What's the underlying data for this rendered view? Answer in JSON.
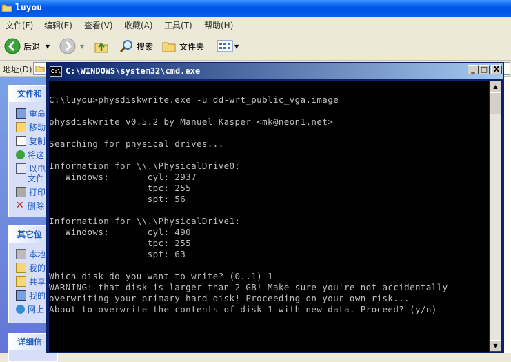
{
  "explorer": {
    "title": "luyou",
    "menu": [
      "文件(F)",
      "编辑(E)",
      "查看(V)",
      "收藏(A)",
      "工具(T)",
      "帮助(H)"
    ],
    "toolbar": {
      "back": "后退",
      "search": "搜索",
      "folders": "文件夹"
    },
    "address_label": "地址(D)",
    "panels": [
      {
        "title": "文件和",
        "items": [
          "重命",
          "移动",
          "复制",
          "将这",
          "以电",
          "文件",
          "打印",
          "删除"
        ]
      },
      {
        "title": "其它位",
        "items": [
          "本地",
          "我的",
          "共享",
          "我的",
          "网上"
        ]
      },
      {
        "title": "详细信",
        "items": []
      }
    ]
  },
  "cmd": {
    "title": "C:\\WINDOWS\\system32\\cmd.exe",
    "icon_label": "C:\\",
    "buttons": {
      "minimize": "_",
      "maximize": "□",
      "close": "X"
    },
    "lines": [
      "C:\\luyou>physdiskwrite.exe -u dd-wrt_public_vga.image",
      "",
      "physdiskwrite v0.5.2 by Manuel Kasper <mk@neon1.net>",
      "",
      "Searching for physical drives...",
      "",
      "Information for \\\\.\\PhysicalDrive0:",
      "   Windows:       cyl: 2937",
      "                  tpc: 255",
      "                  spt: 56",
      "",
      "Information for \\\\.\\PhysicalDrive1:",
      "   Windows:       cyl: 490",
      "                  tpc: 255",
      "                  spt: 63",
      "",
      "Which disk do you want to write? (0..1) 1",
      "WARNING: that disk is larger than 2 GB! Make sure you're not accidentally",
      "overwriting your primary hard disk! Proceeding on your own risk...",
      "About to overwrite the contents of disk 1 with new data. Proceed? (y/n)"
    ]
  }
}
